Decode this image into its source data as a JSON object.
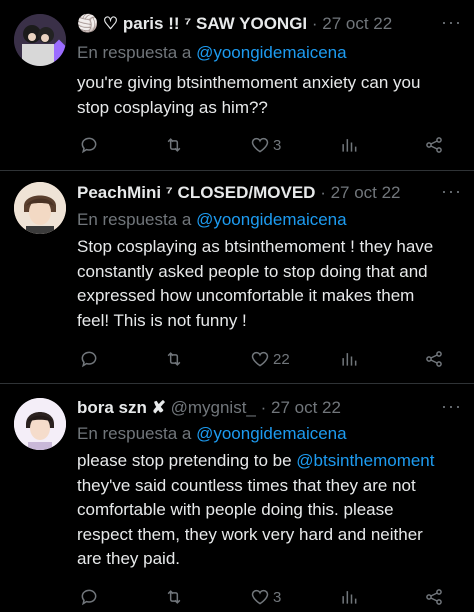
{
  "tweets": [
    {
      "name": "🏐 ♡ paris !! ⁷ SAW YOONGI",
      "handle": "",
      "date": "· 27 oct 22",
      "reply_prefix": "En respuesta a ",
      "reply_to": "@yoongidemaicena",
      "text_before": "you're giving btsinthemoment anxiety can you stop cosplaying as him??",
      "link": "",
      "text_after": "",
      "replies": "",
      "retweets": "",
      "likes": "3",
      "views": ""
    },
    {
      "name": "PeachMini ⁷ CLOSED/MOVED",
      "handle": "",
      "date": "· 27 oct 22",
      "reply_prefix": "En respuesta a ",
      "reply_to": "@yoongidemaicena",
      "text_before": "Stop cosplaying as btsinthemoment ! they have constantly asked people to stop doing that and expressed how uncomfortable it makes them feel! This is not funny !",
      "link": "",
      "text_after": "",
      "replies": "",
      "retweets": "",
      "likes": "22",
      "views": ""
    },
    {
      "name": "bora szn ✘",
      "handle": "@mygnist_",
      "date": "· 27 oct 22",
      "reply_prefix": "En respuesta a ",
      "reply_to": "@yoongidemaicena",
      "text_before": "please stop pretending to be ",
      "link": "@btsinthemoment",
      "text_after": " they've said countless times that they are not comfortable with people doing this. please respect them, they work very hard and neither are they paid.",
      "replies": "",
      "retweets": "",
      "likes": "3",
      "views": ""
    }
  ],
  "more_glyph": "···",
  "colors": {
    "background": "#000000",
    "text": "#e7e9ea",
    "muted": "#71767b",
    "link": "#1d9bf0",
    "divider": "#2f3336"
  },
  "icons": [
    "reply-icon",
    "retweet-icon",
    "like-icon",
    "views-icon",
    "share-icon",
    "more-icon"
  ]
}
